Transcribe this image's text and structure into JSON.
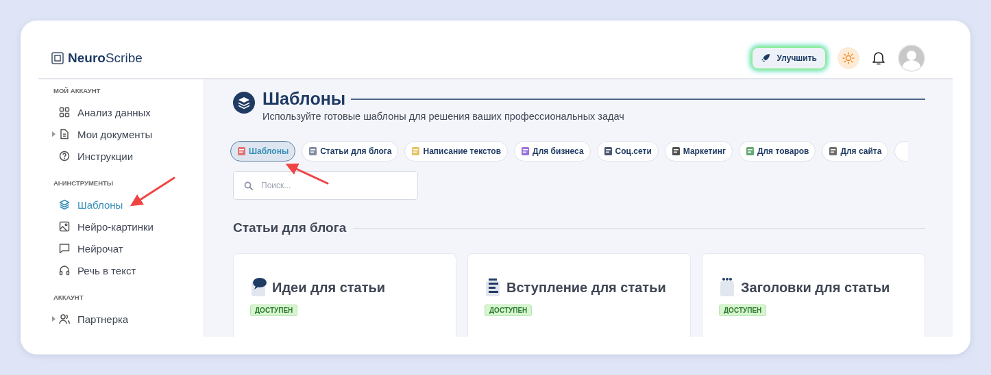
{
  "header": {
    "logo": "**Neuro**Scribe",
    "upgrade_button": "Улучшить"
  },
  "sidebar": {
    "sections": [
      {
        "title": "МОЙ АККАУНТ",
        "items": [
          {
            "label": "Анализ данных",
            "kind": "link",
            "selected": false
          },
          {
            "label": "Мои документы",
            "kind": "group",
            "selected": false
          },
          {
            "label": "Инструкции",
            "kind": "link",
            "selected": false
          }
        ]
      },
      {
        "title": "AI-ИНСТРУМЕНТЫ",
        "items": [
          {
            "label": "Шаблоны",
            "kind": "link",
            "selected": true
          },
          {
            "label": "Нейро-картинки",
            "kind": "link",
            "selected": false
          },
          {
            "label": "Нейрочат",
            "kind": "link",
            "selected": false
          },
          {
            "label": "Речь в текст",
            "kind": "link",
            "selected": false
          }
        ]
      },
      {
        "title": "АККАУНТ",
        "items": [
          {
            "label": "Партнерка",
            "kind": "group",
            "selected": false
          }
        ]
      }
    ]
  },
  "page": {
    "title": "Шаблоны",
    "subtitle": "Используйте готовые шаблоны для решения ваших профессиональных задач"
  },
  "chips": [
    {
      "label": "Шаблоны",
      "selected": true
    },
    {
      "label": "Статьи для блога",
      "selected": false
    },
    {
      "label": "Написание текстов",
      "selected": false
    },
    {
      "label": "Для бизнеса",
      "selected": false
    },
    {
      "label": "Соц.сети",
      "selected": false
    },
    {
      "label": "Маркетинг",
      "selected": false
    },
    {
      "label": "Для товаров",
      "selected": false
    },
    {
      "label": "Для сайта",
      "selected": false
    }
  ],
  "search": {
    "placeholder": "Поиск..."
  },
  "section": {
    "title": "Статьи для блога"
  },
  "cards": [
    {
      "title": "Идеи для статьи",
      "badge": "ДОСТУПЕН"
    },
    {
      "title": "Вступление для статьи",
      "badge": "ДОСТУПЕН"
    },
    {
      "title": "Заголовки для статьи",
      "badge": "ДОСТУПЕН"
    }
  ]
}
